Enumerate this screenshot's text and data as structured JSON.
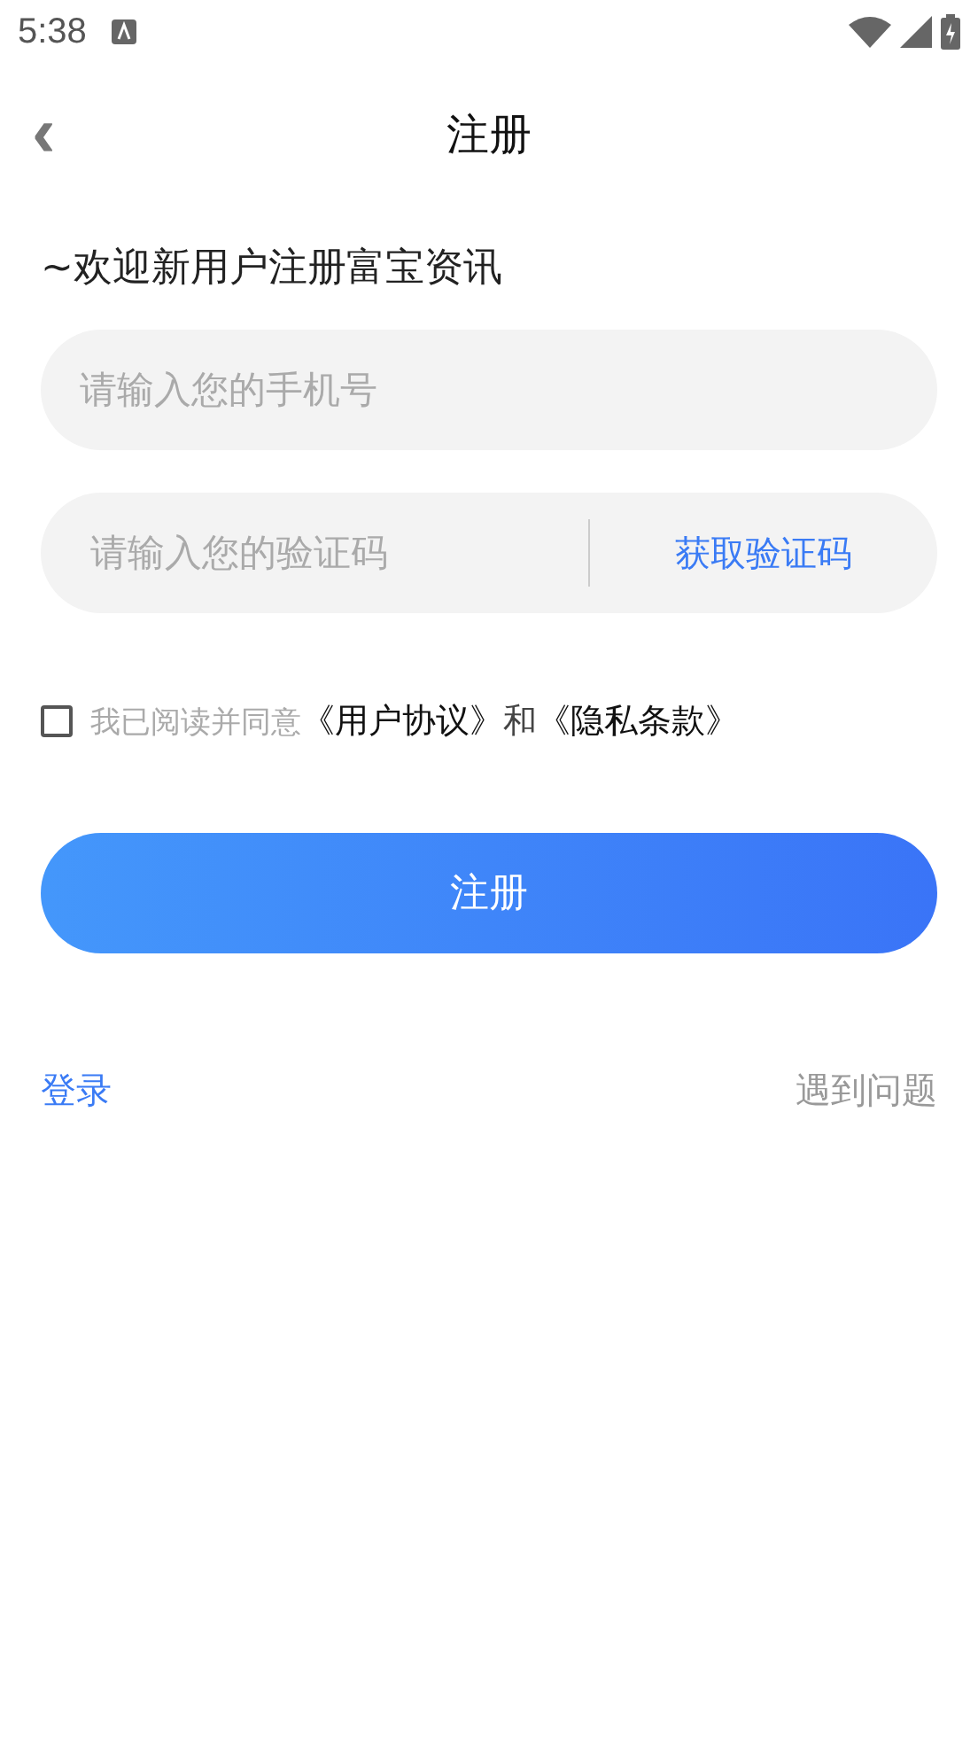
{
  "status_bar": {
    "time": "5:38"
  },
  "header": {
    "back": "‹",
    "title": "注册"
  },
  "welcome": "~欢迎新用户注册富宝资讯",
  "phone_field": {
    "placeholder": "请输入您的手机号"
  },
  "code_field": {
    "placeholder": "请输入您的验证码",
    "action": "获取验证码"
  },
  "agreement": {
    "checked": false,
    "prefix": "我已阅读并同意",
    "parts": [
      {
        "kind": "link",
        "text": "《用户协议》"
      },
      {
        "kind": "text",
        "text": "和"
      },
      {
        "kind": "link",
        "text": "《隐私条款》"
      }
    ]
  },
  "submit": "注册",
  "footer": {
    "login": "登录",
    "help": "遇到问题"
  }
}
